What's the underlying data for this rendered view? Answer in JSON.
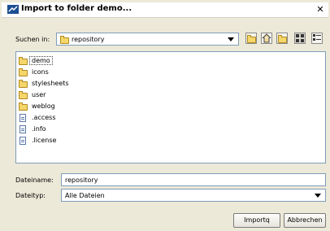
{
  "window": {
    "title": "Import to folder demo..."
  },
  "lookin": {
    "label": "Suchen in:",
    "value": "repository"
  },
  "files": [
    {
      "name": "demo",
      "type": "folder"
    },
    {
      "name": "icons",
      "type": "folder"
    },
    {
      "name": "stylesheets",
      "type": "folder"
    },
    {
      "name": "user",
      "type": "folder"
    },
    {
      "name": "weblog",
      "type": "folder"
    },
    {
      "name": ".access",
      "type": "file"
    },
    {
      "name": ".info",
      "type": "file"
    },
    {
      "name": ".license",
      "type": "file"
    }
  ],
  "filename": {
    "label": "Dateiname:",
    "value": "repository"
  },
  "filetype": {
    "label": "Dateityp:",
    "value": "Alle Dateien"
  },
  "buttons": {
    "import": "Importq",
    "cancel": "Abbrechen"
  }
}
